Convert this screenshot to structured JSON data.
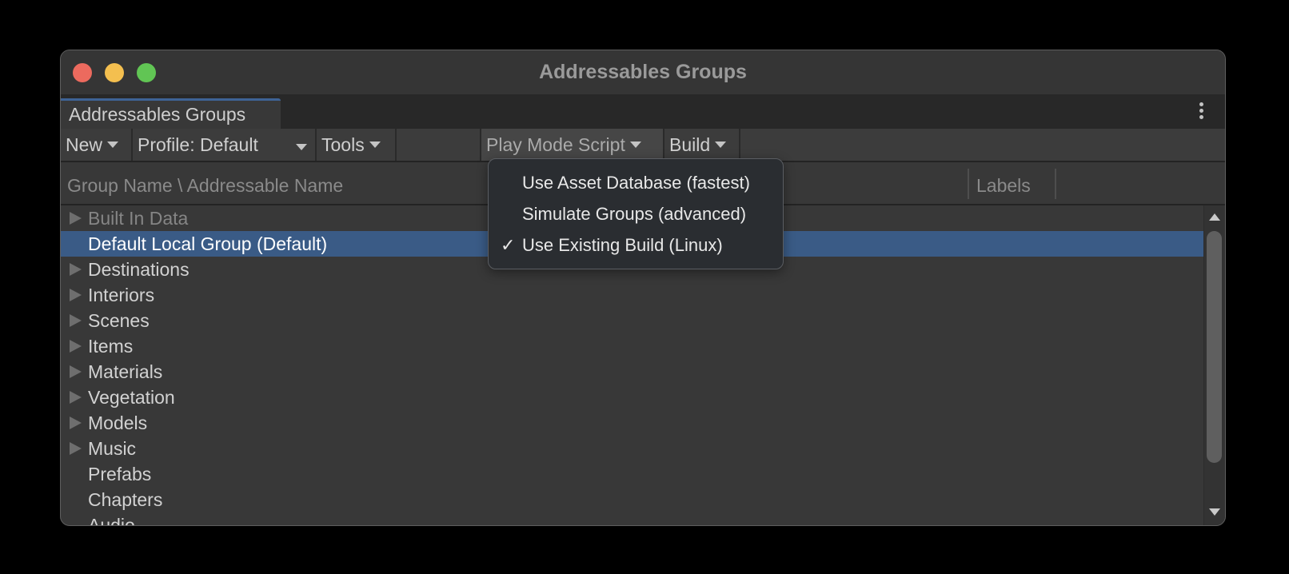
{
  "window": {
    "title": "Addressables Groups"
  },
  "tabs": [
    {
      "label": "Addressables Groups",
      "active": true
    }
  ],
  "toolbar": {
    "new_label": "New",
    "profile_label": "Profile: Default",
    "tools_label": "Tools",
    "play_mode_label": "Play Mode Script",
    "build_label": "Build"
  },
  "columns": {
    "name_header": "Group Name \\ Addressable Name",
    "labels_header": "Labels"
  },
  "groups": [
    {
      "name": "Built In Data",
      "expandable": true,
      "dimmed": true,
      "selected": false
    },
    {
      "name": "Default Local Group (Default)",
      "expandable": false,
      "dimmed": false,
      "selected": true
    },
    {
      "name": "Destinations",
      "expandable": true,
      "dimmed": false,
      "selected": false
    },
    {
      "name": "Interiors",
      "expandable": true,
      "dimmed": false,
      "selected": false
    },
    {
      "name": "Scenes",
      "expandable": true,
      "dimmed": false,
      "selected": false
    },
    {
      "name": "Items",
      "expandable": true,
      "dimmed": false,
      "selected": false
    },
    {
      "name": "Materials",
      "expandable": true,
      "dimmed": false,
      "selected": false
    },
    {
      "name": "Vegetation",
      "expandable": true,
      "dimmed": false,
      "selected": false
    },
    {
      "name": "Models",
      "expandable": true,
      "dimmed": false,
      "selected": false
    },
    {
      "name": "Music",
      "expandable": true,
      "dimmed": false,
      "selected": false
    },
    {
      "name": "Prefabs",
      "expandable": false,
      "dimmed": false,
      "selected": false
    },
    {
      "name": "Chapters",
      "expandable": false,
      "dimmed": false,
      "selected": false
    },
    {
      "name": "Audio",
      "expandable": false,
      "dimmed": false,
      "selected": false
    }
  ],
  "play_mode_menu": {
    "items": [
      {
        "label": "Use Asset Database (fastest)",
        "checked": false
      },
      {
        "label": "Simulate Groups (advanced)",
        "checked": false
      },
      {
        "label": "Use Existing Build (Linux)",
        "checked": true
      }
    ],
    "check_glyph": "✓"
  },
  "colors": {
    "selection": "#3a5b86",
    "tab_accent": "#3e6396",
    "close": "#ec6a5e",
    "minimize": "#f4bf4f",
    "zoom": "#61c554"
  }
}
